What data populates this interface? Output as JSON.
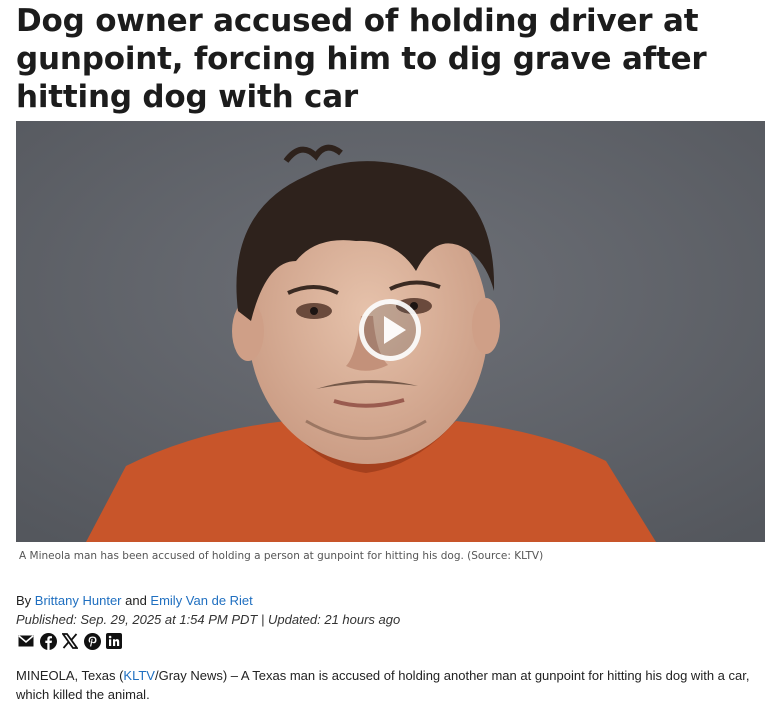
{
  "article": {
    "headline": "Dog owner accused of holding driver at gunpoint, forcing him to dig grave after hitting dog with car",
    "caption": "A Mineola man has been accused of holding a person at gunpoint for hitting his dog. (Source: KLTV)",
    "byline": {
      "prefix": "By ",
      "author1": "Brittany Hunter",
      "joiner": " and ",
      "author2": "Emily Van de Riet"
    },
    "dates": "Published: Sep. 29, 2025 at 1:54 PM PDT | Updated: 21 hours ago",
    "share_icons": [
      "email-icon",
      "facebook-icon",
      "x-icon",
      "pinterest-icon",
      "linkedin-icon"
    ],
    "lede": {
      "before": "MINEOLA, Texas (",
      "link": "KLTV",
      "after": "/Gray News) – A Texas man is accused of holding another man at gunpoint for hitting his dog with a car, which killed the animal."
    }
  },
  "colors": {
    "link": "#1f6fc0",
    "photo_background": "#5f6268",
    "jumpsuit": "#c8552a"
  }
}
